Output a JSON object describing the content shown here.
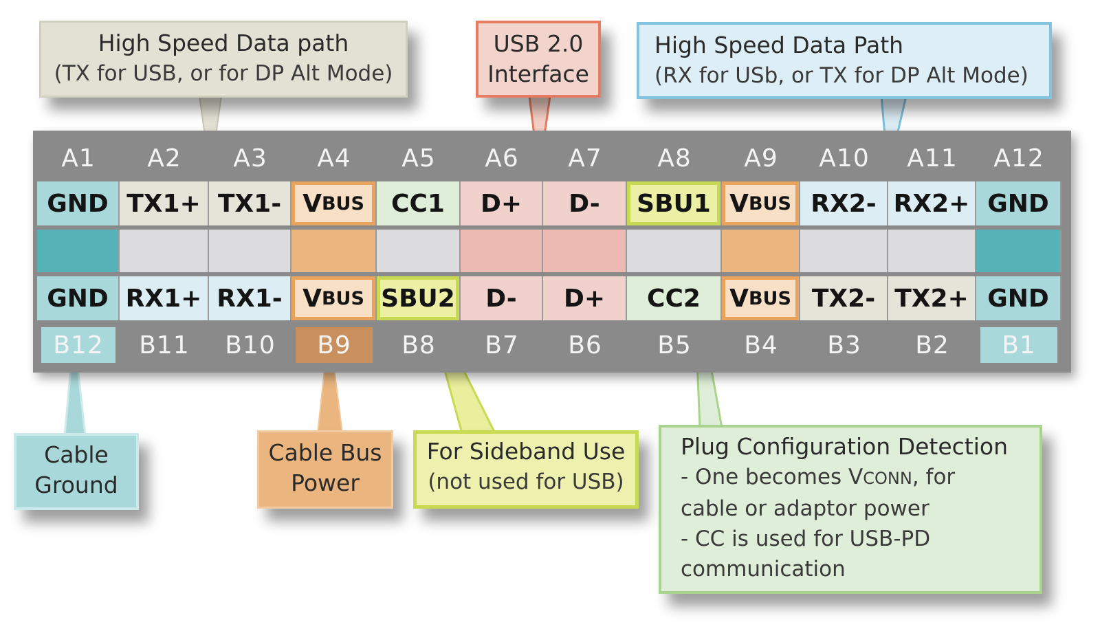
{
  "colors": {
    "connector": "#8a8a8a",
    "gnd": "#a9d8da",
    "gnd_mid": "#56b4b8",
    "tx": "#e5e4d8",
    "rx": "#dcedf4",
    "vbus": "#f8e0c6",
    "vbus_mid": "#eab57e",
    "vbus_border": "#e9a35d",
    "cc": "#dfeed8",
    "dline": "#f1d1cc",
    "dline_mid": "#ecb9b3",
    "sbu": "#ecf0a4",
    "sbu_border": "#c8da52",
    "blank_mid": "#dcdcde"
  },
  "top_pins": [
    "A1",
    "A2",
    "A3",
    "A4",
    "A5",
    "A6",
    "A7",
    "A8",
    "A9",
    "A10",
    "A11",
    "A12"
  ],
  "bottom_pins": [
    "B12",
    "B11",
    "B10",
    "B9",
    "B8",
    "B7",
    "B6",
    "B5",
    "B4",
    "B3",
    "B2",
    "B1"
  ],
  "top_row": [
    {
      "main": "GND",
      "type": "gnd"
    },
    {
      "main": "TX1+",
      "type": "tx"
    },
    {
      "main": "TX1-",
      "type": "tx"
    },
    {
      "main": "V",
      "sub": "BUS",
      "type": "vbus"
    },
    {
      "main": "CC1",
      "type": "cc"
    },
    {
      "main": "D+",
      "type": "dline"
    },
    {
      "main": "D-",
      "type": "dline"
    },
    {
      "main": "SBU1",
      "type": "sbu"
    },
    {
      "main": "V",
      "sub": "BUS",
      "type": "vbus"
    },
    {
      "main": "RX2-",
      "type": "rx"
    },
    {
      "main": "RX2+",
      "type": "rx"
    },
    {
      "main": "GND",
      "type": "gnd"
    }
  ],
  "bottom_row": [
    {
      "main": "GND",
      "type": "gnd"
    },
    {
      "main": "RX1+",
      "type": "rx"
    },
    {
      "main": "RX1-",
      "type": "rx"
    },
    {
      "main": "V",
      "sub": "BUS",
      "type": "vbus"
    },
    {
      "main": "SBU2",
      "type": "sbu"
    },
    {
      "main": "D-",
      "type": "dline"
    },
    {
      "main": "D+",
      "type": "dline"
    },
    {
      "main": "CC2",
      "type": "cc"
    },
    {
      "main": "V",
      "sub": "BUS",
      "type": "vbus"
    },
    {
      "main": "TX2-",
      "type": "tx"
    },
    {
      "main": "TX2+",
      "type": "tx"
    },
    {
      "main": "GND",
      "type": "gnd"
    }
  ],
  "callouts": {
    "hs_tx": {
      "title": "High Speed Data path",
      "subtitle": "(TX for USB, or for DP Alt Mode)"
    },
    "usb2": {
      "line1": "USB 2.0",
      "line2": "Interface"
    },
    "hs_rx": {
      "title": "High Speed Data Path",
      "subtitle": "(RX for USb, or TX for DP Alt Mode)"
    },
    "cable_ground": {
      "line1": "Cable",
      "line2": "Ground"
    },
    "cable_bus_power": {
      "line1": "Cable Bus",
      "line2": "Power"
    },
    "sideband": {
      "title": "For Sideband Use",
      "subtitle": "(not used for USB)"
    },
    "plug_config": {
      "title": "Plug Configuration Detection",
      "line1_pre": "- One becomes V",
      "line1_sub": "CONN",
      "line1_post": ", for",
      "line2": "cable or adaptor power",
      "line3": "- CC is used for USB-PD",
      "line4": "communication"
    }
  }
}
